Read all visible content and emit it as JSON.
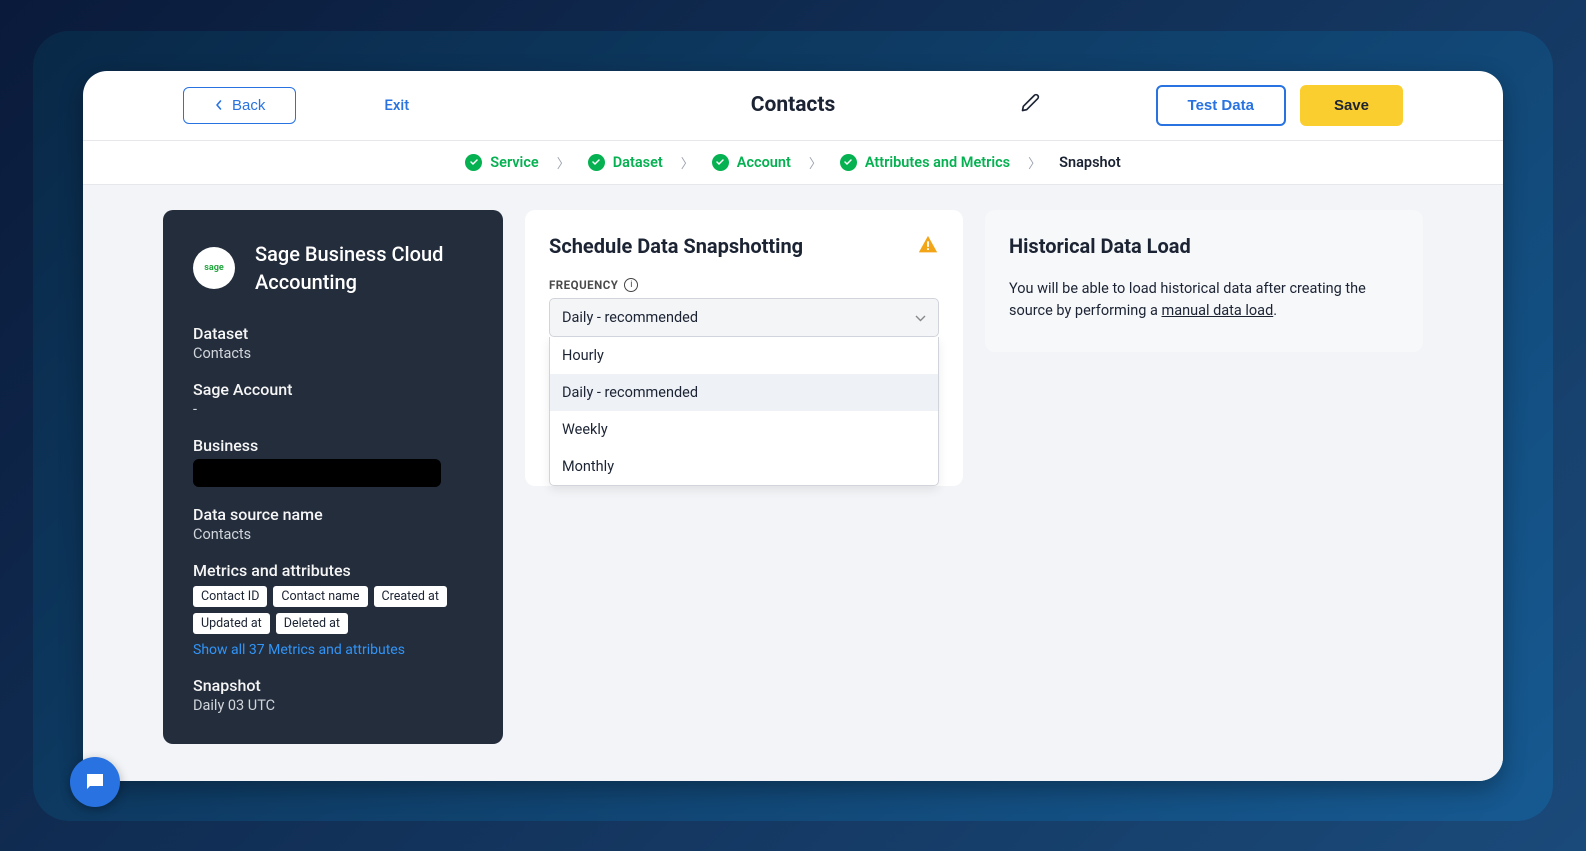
{
  "header": {
    "back_label": "Back",
    "exit_label": "Exit",
    "title": "Contacts",
    "test_label": "Test Data",
    "save_label": "Save"
  },
  "breadcrumb": {
    "items": [
      {
        "label": "Service",
        "done": true
      },
      {
        "label": "Dataset",
        "done": true
      },
      {
        "label": "Account",
        "done": true
      },
      {
        "label": "Attributes and Metrics",
        "done": true
      },
      {
        "label": "Snapshot",
        "done": false
      }
    ]
  },
  "sidebar": {
    "logo_text": "sage",
    "integration_name": "Sage Business Cloud Accounting",
    "fields": {
      "dataset": {
        "label": "Dataset",
        "value": "Contacts"
      },
      "account": {
        "label": "Sage Account",
        "value": "-"
      },
      "business": {
        "label": "Business",
        "value": ""
      },
      "source_name": {
        "label": "Data source name",
        "value": "Contacts"
      },
      "metrics": {
        "label": "Metrics and attributes"
      },
      "snapshot": {
        "label": "Snapshot",
        "value": "Daily  03  UTC"
      }
    },
    "tags": [
      "Contact ID",
      "Contact name",
      "Created at",
      "Updated at",
      "Deleted at"
    ],
    "show_all": "Show all 37 Metrics and attributes"
  },
  "schedule_card": {
    "title": "Schedule Data Snapshotting",
    "frequency_label": "FREQUENCY",
    "selected": "Daily - recommended",
    "options": [
      "Hourly",
      "Daily - recommended",
      "Weekly",
      "Monthly"
    ]
  },
  "historical_card": {
    "title": "Historical Data Load",
    "text_before": "You will be able to load historical data after creating the source by performing a ",
    "link_text": "manual data load",
    "text_after": "."
  }
}
